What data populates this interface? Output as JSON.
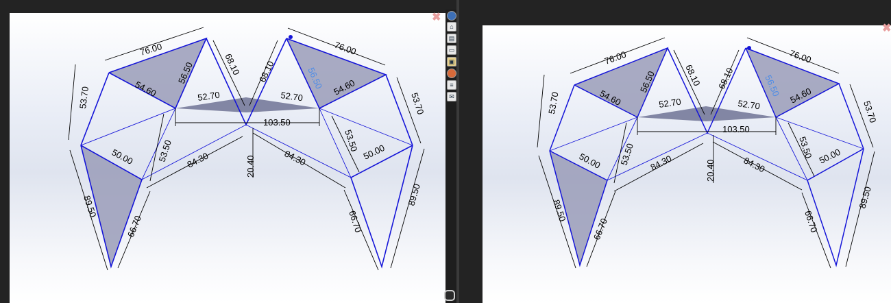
{
  "left_view": {
    "dimensions": {
      "d76a": "76.00",
      "d53_70": "53.70",
      "d54_60": "54.60",
      "d56_50": "56.50",
      "d68_10a": "68.10",
      "d68_10b": "68.10",
      "d52_70a": "52.70",
      "d52_70b": "52.70",
      "d76b": "76.00",
      "d56_50_blue": "56.50",
      "d54_60b": "54.60",
      "d53_70b": "53.70",
      "d103_50": "103.50",
      "d50a": "50.00",
      "d53_50a": "53.50",
      "d84_30a": "84.30",
      "d20_40": "20.40",
      "d84_30b": "84.30",
      "d53_50b": "53.50",
      "d50b": "50.00",
      "d89_50a": "89.50",
      "d66_70a": "66.70",
      "d66_70b": "66.70",
      "d89_50b": "89.50"
    }
  },
  "right_view": {
    "dimensions": {
      "d76a": "76.00",
      "d53_70": "53.70",
      "d54_60": "54.60",
      "d56_50": "56.50",
      "d68_10a": "68.10",
      "d68_10b": "68.10",
      "d52_70a": "52.70",
      "d52_70b": "52.70",
      "d76b": "76.00",
      "d56_50_blue": "56.50",
      "d54_60b": "54.60",
      "d53_70b": "53.70",
      "d103_50": "103.50",
      "d50a": "50.00",
      "d53_50a": "53.50",
      "d84_30a": "84.30",
      "d20_40": "20.40",
      "d84_30b": "84.30",
      "d53_50b": "53.50",
      "d50b": "50.00",
      "d89_50a": "89.50",
      "d66_70a": "66.70",
      "d66_70b": "66.70",
      "d89_50b": "89.50"
    }
  },
  "toolbar": {
    "icons": [
      "globe-icon",
      "home-icon",
      "layers-icon",
      "folder-icon",
      "palette-image-icon",
      "color-wheel-icon",
      "list-icon",
      "chat-icon"
    ]
  },
  "colors": {
    "sketch_blue": "#1515d8",
    "dim_black": "#000000",
    "dim_blue": "#4f8de6",
    "face_fill": "#9a9cb8",
    "close_x": "#e9a0a0"
  }
}
